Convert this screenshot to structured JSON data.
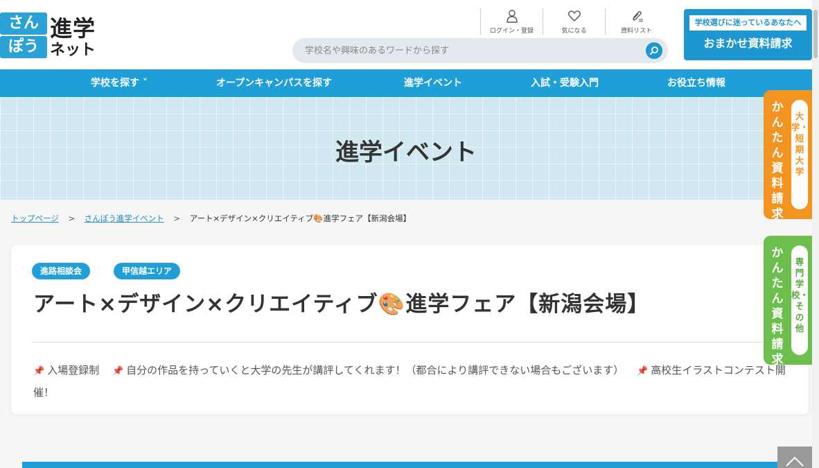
{
  "logo": {
    "box1": "さん",
    "box2": "ぽう",
    "text1": "進学",
    "text2": "ネット"
  },
  "util_nav": [
    {
      "label": "ログイン・登録",
      "icon": "user-icon"
    },
    {
      "label": "気になる",
      "icon": "heart-icon"
    },
    {
      "label": "資料リスト",
      "icon": "clip-icon"
    }
  ],
  "search": {
    "placeholder": "学校名や興味のあるワードから探す"
  },
  "omakase": {
    "top": "学校選びに迷っているあなたへ",
    "main": "おまかせ資料請求"
  },
  "gnav": {
    "items": [
      {
        "label": "学校を探す ˅"
      },
      {
        "label": "オープンキャンパスを探す"
      },
      {
        "label": "進学イベント"
      },
      {
        "label": "入試・受験入門"
      },
      {
        "label": "お役立ち情報"
      }
    ]
  },
  "hero": {
    "title": "進学イベント"
  },
  "breadcrumb": {
    "home": "トップページ",
    "events": "さんぽう進学イベント",
    "current": "アート×デザイン×クリエイティブ🎨進学フェア【新潟会場】",
    "sep": ">"
  },
  "event": {
    "tags": [
      "進路相談会",
      "甲信越エリア"
    ],
    "title": "アート×デザイン×クリエイティブ🎨進学フェア【新潟会場】",
    "notes": [
      "入場登録制",
      "自分の作品を持っていくと大学の先生が講評してくれます！（都合により講評できない場合もございます）",
      "高校生イラストコンテスト開催！"
    ],
    "pin": "📌"
  },
  "side_tabs": {
    "orange": {
      "main": "かんたん資料請求",
      "sub": "大学・短期大学"
    },
    "green": {
      "main": "かんたん資料請求",
      "sub": "専門学校・その他"
    }
  },
  "colors": {
    "brand": "#1e9fd8",
    "orange": "#f39320",
    "green": "#6cbf4c",
    "pin": "#e0336b"
  }
}
